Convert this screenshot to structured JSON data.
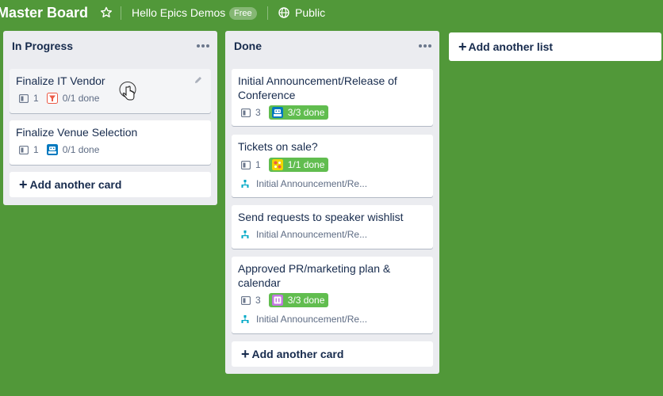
{
  "header": {
    "board_title": "Master Board",
    "team_name": "Hello Epics Demos",
    "plan_badge": "Free",
    "visibility": "Public"
  },
  "lists": [
    {
      "title": "In Progress",
      "cards": [
        {
          "title": "Finalize IT Vendor",
          "desc_count": "1",
          "checklist": "0/1 done"
        },
        {
          "title": "Finalize Venue Selection",
          "desc_count": "1",
          "checklist": "0/1 done"
        }
      ],
      "add_card_label": "Add another card"
    },
    {
      "title": "Done",
      "cards": [
        {
          "title": "Initial Announcement/Release of Conference",
          "desc_count": "3",
          "checklist": "3/3 done"
        },
        {
          "title": "Tickets on sale?",
          "desc_count": "1",
          "checklist": "1/1 done",
          "epic": "Initial Announcement/Re..."
        },
        {
          "title": "Send requests to speaker wishlist",
          "epic": "Initial Announcement/Re..."
        },
        {
          "title": "Approved PR/marketing plan & calendar",
          "desc_count": "3",
          "checklist": "3/3 done",
          "epic": "Initial Announcement/Re..."
        }
      ],
      "add_card_label": "Add another card"
    }
  ],
  "add_list_label": "Add another list",
  "colors": {
    "board_background": "#519839",
    "list_background": "#ebecf0",
    "checklist_done": "#61bd4f",
    "epic_accent": "#00a9c7"
  }
}
